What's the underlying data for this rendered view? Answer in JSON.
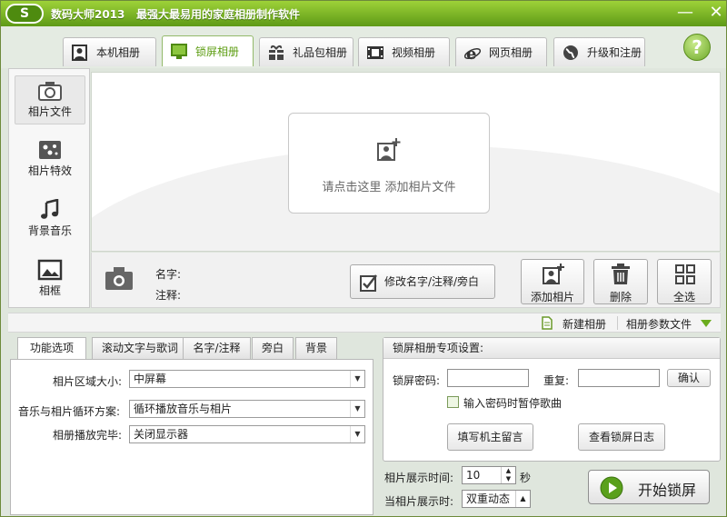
{
  "window": {
    "app_name": "数码大师2013",
    "tagline": "最强大最易用的家庭相册制作软件",
    "minimize_glyph": "—",
    "close_glyph": "✕",
    "logo_text": "S"
  },
  "top_tabs": [
    {
      "label": "本机相册",
      "icon": "person-album-icon"
    },
    {
      "label": "锁屏相册",
      "icon": "monitor-icon",
      "active": true
    },
    {
      "label": "礼品包相册",
      "icon": "gift-icon"
    },
    {
      "label": "视频相册",
      "icon": "film-icon"
    },
    {
      "label": "网页相册",
      "icon": "ie-icon"
    },
    {
      "label": "升级和注册",
      "icon": "globe-icon"
    }
  ],
  "help_glyph": "?",
  "sidebar": {
    "items": [
      {
        "label": "相片文件",
        "icon": "camera-icon",
        "active": true
      },
      {
        "label": "相片特效",
        "icon": "effects-icon"
      },
      {
        "label": "背景音乐",
        "icon": "music-note-icon"
      },
      {
        "label": "相框",
        "icon": "picture-frame-icon"
      }
    ]
  },
  "canvas": {
    "drop_hint": "请点击这里  添加相片文件"
  },
  "photo_info": {
    "name_label": "名字:",
    "note_label": "注释:",
    "edit_button": "修改名字/注释/旁白",
    "add_photo": "添加相片",
    "delete": "删除",
    "select_all": "全选"
  },
  "toolstrip": {
    "new_album": "新建相册",
    "param_file": "相册参数文件"
  },
  "left_tabs": [
    "功能选项",
    "滚动文字与歌词",
    "名字/注释",
    "旁白",
    "背景"
  ],
  "options": {
    "photo_area_label": "相片区域大小:",
    "photo_area_value": "中屏幕",
    "loop_label": "音乐与相片循环方案:",
    "loop_value": "循环播放音乐与相片",
    "finish_label": "相册播放完毕:",
    "finish_value": "关闭显示器"
  },
  "lock_settings": {
    "header": "锁屏相册专项设置:",
    "password_label": "锁屏密码:",
    "password_value": "",
    "repeat_label": "重复:",
    "repeat_value": "",
    "confirm": "确认",
    "pause_song_label": "输入密码时暂停歌曲",
    "pause_song_checked": false,
    "owner_message": "填写机主留言",
    "view_log": "查看锁屏日志"
  },
  "display": {
    "time_label": "相片展示时间:",
    "time_value": "10",
    "time_unit": "秒",
    "during_label": "当相片展示时:",
    "during_value": "双重动态"
  },
  "start_button": "开始锁屏",
  "colors": {
    "title_green": "#6fae1e",
    "active_tab_text": "#5d9d12"
  }
}
